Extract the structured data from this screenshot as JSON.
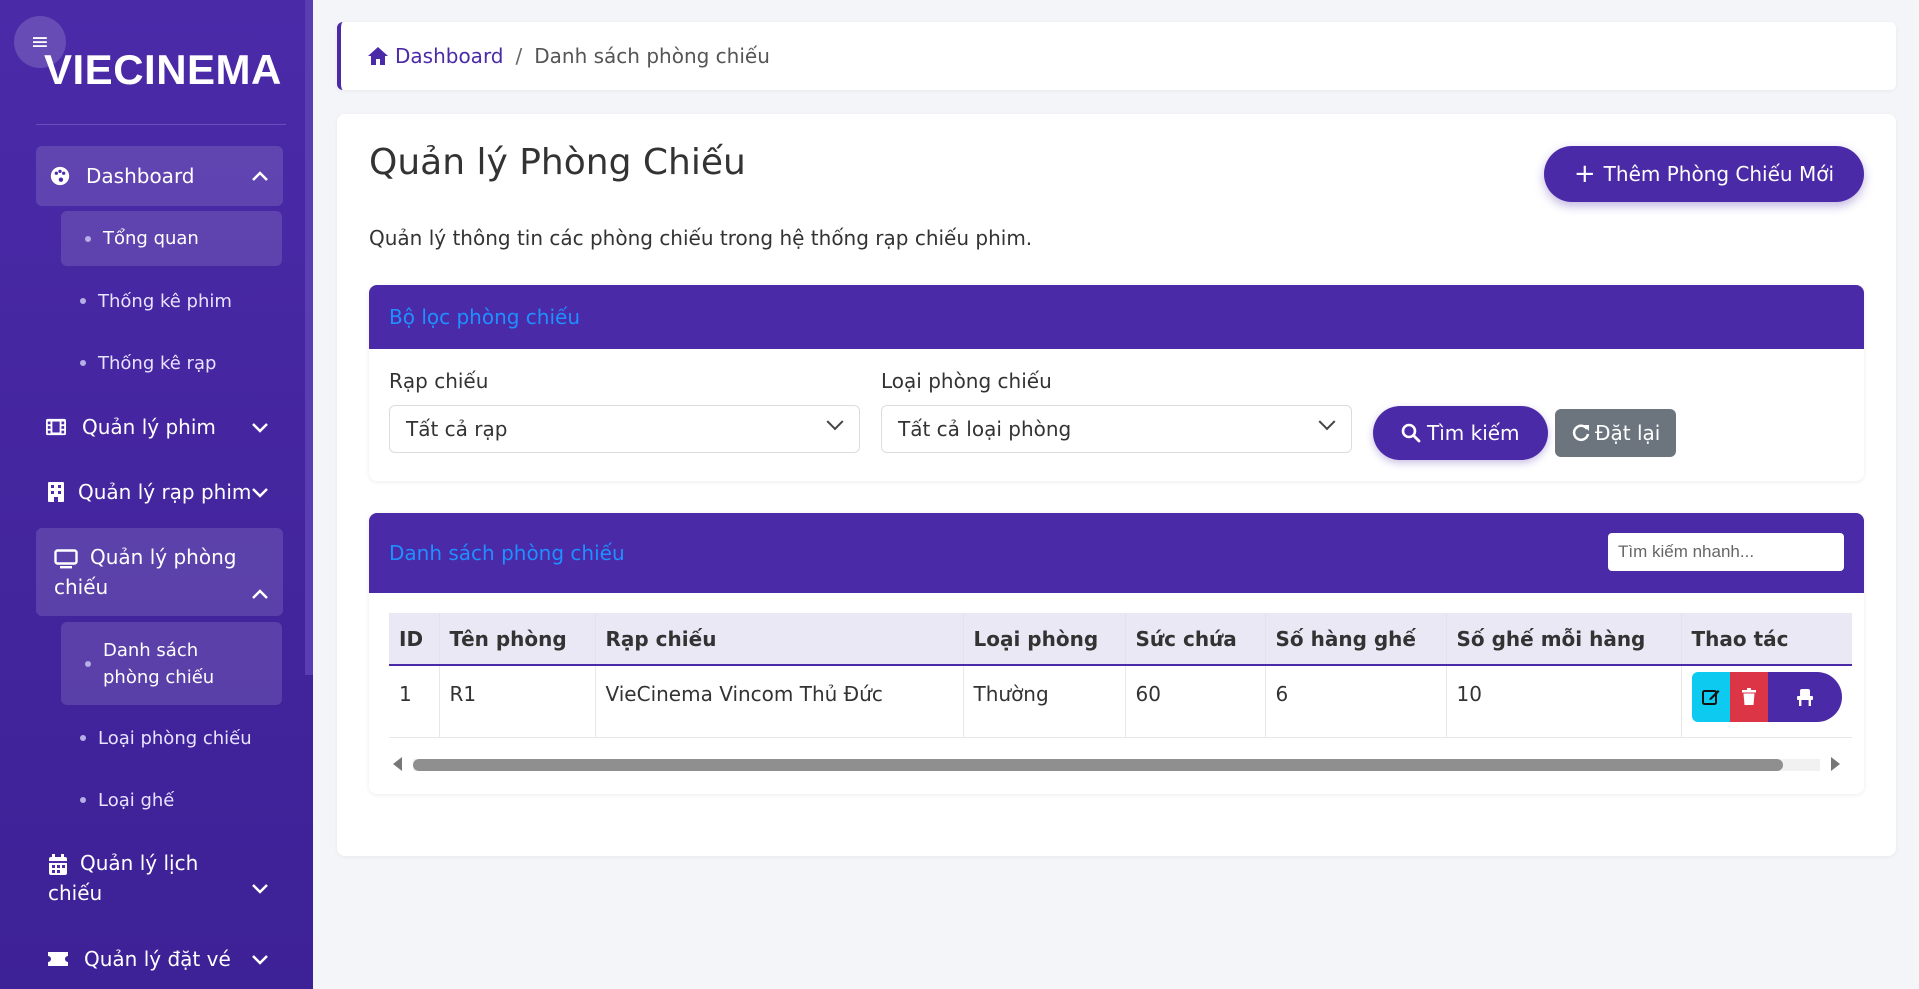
{
  "sidebar": {
    "brand": "VIECINEMA",
    "groups": [
      {
        "label": "Dashboard",
        "icon": "palette-icon",
        "expanded": true,
        "items": [
          "Tổng quan",
          "Thống kê phim",
          "Thống kê rạp"
        ]
      },
      {
        "label": "Quản lý phim",
        "icon": "film-icon"
      },
      {
        "label": "Quản lý rạp phim",
        "icon": "building-icon"
      },
      {
        "label_line1": "Quản lý phòng",
        "label_line2": "chiếu",
        "icon": "monitor-icon",
        "expanded": true,
        "items": [
          {
            "line1": "Danh sách",
            "line2": "phòng chiếu"
          },
          "Loại phòng chiếu",
          "Loại ghế"
        ]
      },
      {
        "label_line1": "Quản lý lịch",
        "label_line2": "chiếu",
        "icon": "calendar-icon"
      },
      {
        "label": "Quản lý đặt vé",
        "icon": "ticket-icon"
      }
    ]
  },
  "breadcrumb": {
    "home": "Dashboard",
    "separator": "/",
    "current": "Danh sách phòng chiếu"
  },
  "page": {
    "title": "Quản lý Phòng Chiếu",
    "add_button": "Thêm Phòng Chiếu Mới",
    "description": "Quản lý thông tin các phòng chiếu trong hệ thống rạp chiếu phim."
  },
  "filter": {
    "title": "Bộ lọc phòng chiếu",
    "cinema_label": "Rạp chiếu",
    "cinema_value": "Tất cả rạp",
    "type_label": "Loại phòng chiếu",
    "type_value": "Tất cả loại phòng",
    "search_button": "Tìm kiếm",
    "reset_button": "Đặt lại"
  },
  "list": {
    "title": "Danh sách phòng chiếu",
    "quick_search_placeholder": "Tìm kiếm nhanh...",
    "columns": [
      "ID",
      "Tên phòng",
      "Rạp chiếu",
      "Loại phòng",
      "Sức chứa",
      "Số hàng ghế",
      "Số ghế mỗi hàng",
      "Thao tác"
    ],
    "rows": [
      {
        "id": "1",
        "name": "R1",
        "cinema": "VieCinema Vincom Thủ Đức",
        "type": "Thường",
        "capacity": "60",
        "rows": "6",
        "seats_per_row": "10"
      }
    ]
  },
  "colors": {
    "primary": "#4b2aa8",
    "edit": "#0dcaf0",
    "delete": "#dc3545",
    "reset": "#6c757d",
    "header_link": "#1e90ff"
  }
}
